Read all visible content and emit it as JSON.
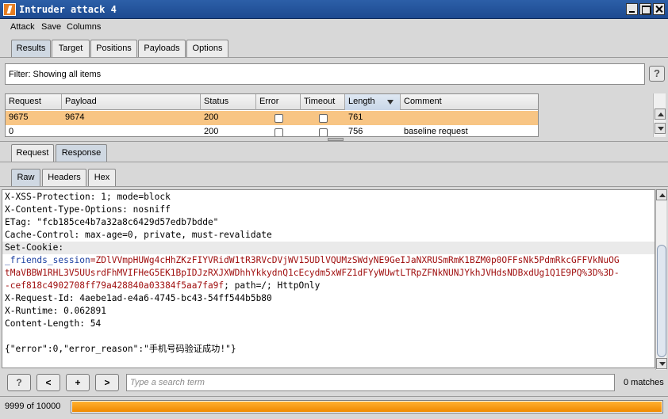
{
  "window": {
    "title": "Intruder attack 4"
  },
  "menu": [
    "Attack",
    "Save",
    "Columns"
  ],
  "top_tabs": [
    "Results",
    "Target",
    "Positions",
    "Payloads",
    "Options"
  ],
  "top_tab_active": "Results",
  "filter": {
    "text": "Filter: Showing all items",
    "help": "?"
  },
  "table": {
    "columns": [
      "Request",
      "Payload",
      "Status",
      "Error",
      "Timeout",
      "Length",
      "Comment"
    ],
    "sorted_column": "Length",
    "rows": [
      {
        "request": "9675",
        "payload": "9674",
        "status": "200",
        "error": false,
        "timeout": false,
        "length": "761",
        "comment": "",
        "selected": true
      },
      {
        "request": "0",
        "payload": "",
        "status": "200",
        "error": false,
        "timeout": false,
        "length": "756",
        "comment": "baseline request",
        "selected": false
      }
    ]
  },
  "msg_tabs": [
    "Request",
    "Response"
  ],
  "msg_tab_active": "Response",
  "view_tabs": [
    "Raw",
    "Headers",
    "Hex"
  ],
  "view_tab_active": "Raw",
  "response": {
    "lines_before": [
      "X-XSS-Protection: 1; mode=block",
      "X-Content-Type-Options: nosniff",
      "ETag: \"fcb185ce4b7a32a8c6429d57edb7bdde\"",
      "Cache-Control: max-age=0, private, must-revalidate"
    ],
    "set_cookie_label": "Set-Cookie:",
    "cookie_name": "_friends_session",
    "cookie_value_line1": "=ZDlVVmpHUWg4cHhZKzFIYVRidW1tR3RVcDVjWV15UDlVQUMzSWdyNE9GeIJaNXRUSmRmK1BZM0p0OFFsNk5PdmRkcGFFVkNuOG",
    "cookie_value_line2": "tMaVBBW1RHL3V5UUsrdFhMVIFHeG5EK1BpIDJzRXJXWDhhYkkydnQ1cEcydm5xWFZ1dFYyWUwtLTRpZFNkNUNJYkhJVHdsNDBxdUg1Q1E9PQ%3D%3D-",
    "cookie_value_line3": "-cef818c4902708ff79a428840a03384f5aa7fa9f",
    "cookie_rest": "; path=/; HttpOnly",
    "lines_after": [
      "X-Request-Id: 4aebe1ad-e4a6-4745-bc43-54ff544b5b80",
      "X-Runtime: 0.062891",
      "Content-Length: 54"
    ],
    "body": "{\"error\":0,\"error_reason\":\"手机号码验证成功!\"}"
  },
  "search": {
    "placeholder": "Type a search term",
    "matches": "0 matches",
    "help": "?",
    "prev": "<",
    "add": "+",
    "next": ">"
  },
  "status": {
    "text": "9999 of 10000",
    "progress": 0.9999
  }
}
